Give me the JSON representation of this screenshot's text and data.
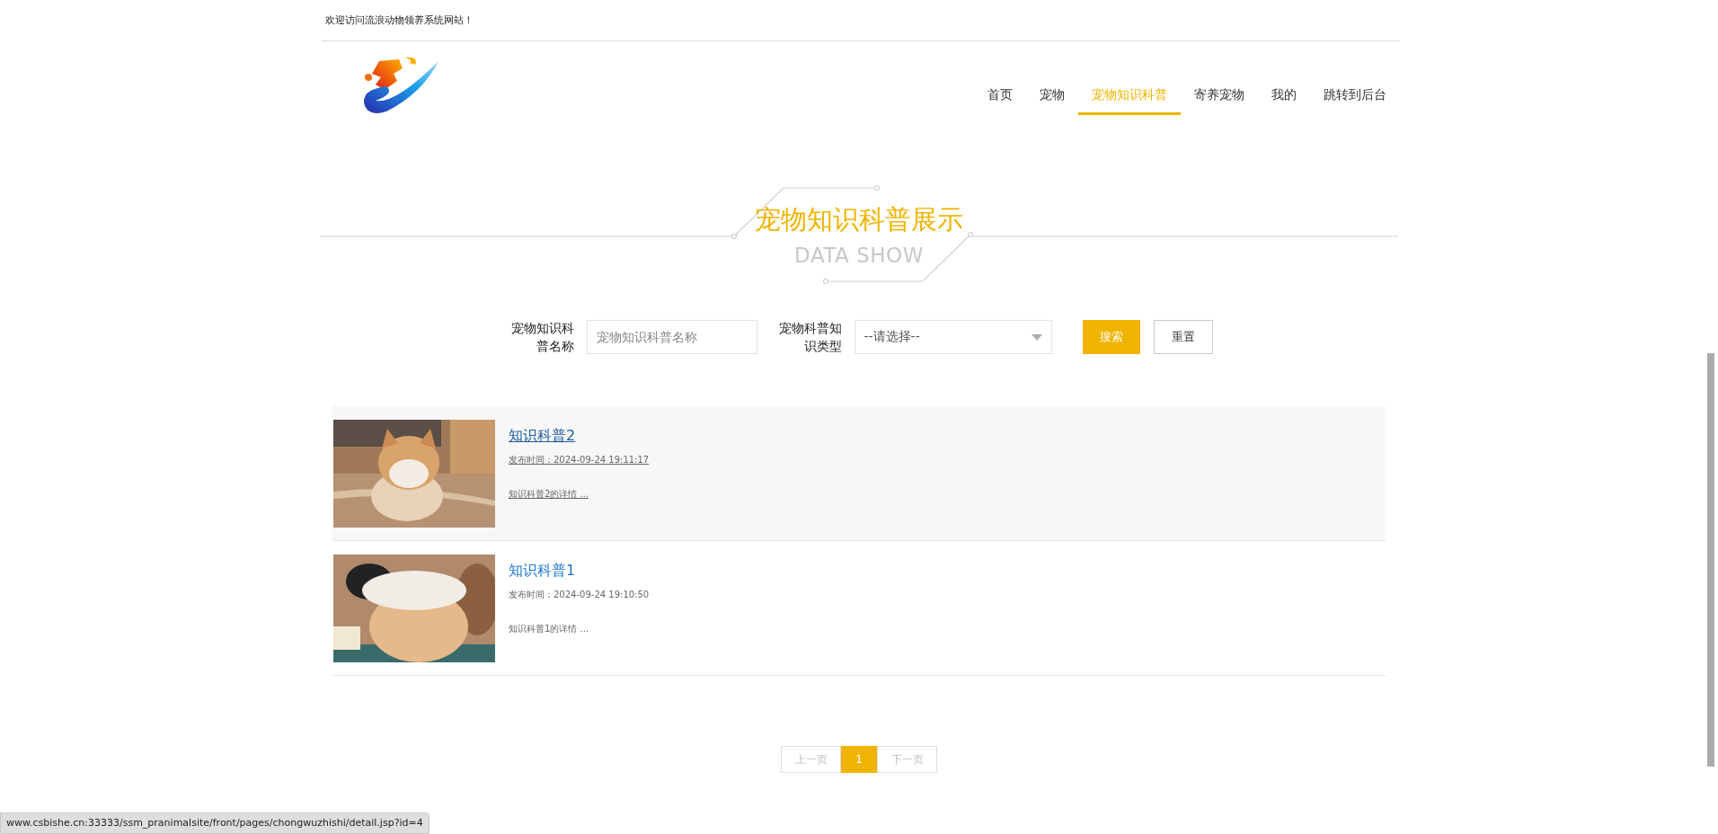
{
  "welcome": "欢迎访问流浪动物领养系统网站！",
  "nav": [
    {
      "label": "首页",
      "selected": false
    },
    {
      "label": "宠物",
      "selected": false
    },
    {
      "label": "宠物知识科普",
      "selected": true
    },
    {
      "label": "寄养宠物",
      "selected": false
    },
    {
      "label": "我的",
      "selected": false
    },
    {
      "label": "跳转到后台",
      "selected": false
    }
  ],
  "section": {
    "title": "宠物知识科普展示",
    "subtitle": "DATA SHOW"
  },
  "search": {
    "name_label": "宠物知识科普名称",
    "name_placeholder": "宠物知识科普名称",
    "type_label": "宠物科普知识类型",
    "type_value": "--请选择--",
    "search_button": "搜索",
    "reset_button": "重置"
  },
  "articles": [
    {
      "title": "知识科普2",
      "date": "发布时间：2024-09-24 19:11:17",
      "summary": "知识科普2的详情 ...",
      "hovered": true
    },
    {
      "title": "知识科普1",
      "date": "发布时间：2024-09-24 19:10:50",
      "summary": "知识科普1的详情 ...",
      "hovered": false
    }
  ],
  "pagination": {
    "prev": "上一页",
    "pages": [
      {
        "label": "1",
        "selected": true
      }
    ],
    "next": "下一页"
  },
  "status_bar": "www.csbishe.cn:33333/ssm_pranimalsite/front/pages/chongwuzhishi/detail.jsp?id=4"
}
